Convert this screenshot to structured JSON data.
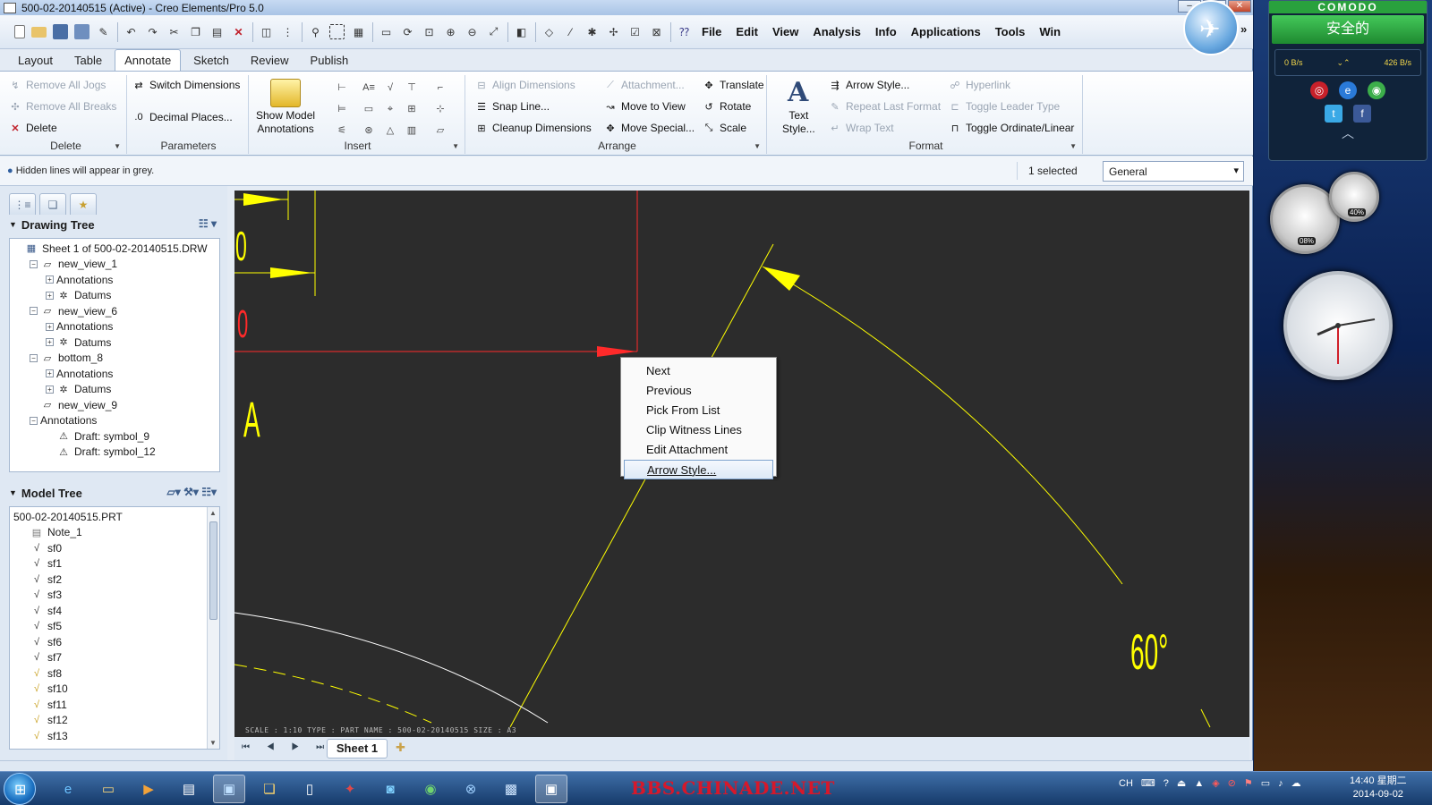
{
  "window": {
    "title": "500-02-20140515 (Active) - Creo Elements/Pro 5.0",
    "min_label": "–",
    "max_label": "❐",
    "close_label": "✕"
  },
  "menus": [
    "File",
    "Edit",
    "View",
    "Analysis",
    "Info",
    "Applications",
    "Tools",
    "Win"
  ],
  "more_label": "»",
  "ribbon_tabs": [
    "Layout",
    "Table",
    "Annotate",
    "Sketch",
    "Review",
    "Publish"
  ],
  "active_tab": "Annotate",
  "ribbon": {
    "delete_group": {
      "label": "Delete",
      "remove_jogs": "Remove All Jogs",
      "remove_breaks": "Remove All Breaks",
      "delete": "Delete"
    },
    "parameters_group": {
      "label": "Parameters",
      "switch_dimensions": "Switch Dimensions",
      "decimal_places": "Decimal Places..."
    },
    "insert_group": {
      "label": "Insert",
      "show_model_annotations_1": "Show Model",
      "show_model_annotations_2": "Annotations"
    },
    "arrange_group": {
      "label": "Arrange",
      "align_dimensions": "Align Dimensions",
      "snap_line": "Snap Line...",
      "cleanup_dimensions": "Cleanup Dimensions",
      "attachment": "Attachment...",
      "move_to_view": "Move to View",
      "move_special": "Move Special...",
      "translate": "Translate",
      "rotate": "Rotate",
      "scale": "Scale"
    },
    "format_group": {
      "label": "Format",
      "text_style_1": "Text",
      "text_style_2": "Style...",
      "arrow_style": "Arrow Style...",
      "repeat_last_format": "Repeat Last Format",
      "wrap_text": "Wrap Text",
      "hyperlink": "Hyperlink",
      "toggle_leader_type": "Toggle Leader Type",
      "toggle_ordinate": "Toggle Ordinate/Linear"
    }
  },
  "message_bar": {
    "message": "Hidden lines will appear in grey.",
    "selected": "1 selected",
    "filter": "General"
  },
  "drawing_tree": {
    "title": "Drawing Tree",
    "items": [
      {
        "label": "Sheet 1 of 500-02-20140515.DRW",
        "level": 0,
        "exp": "",
        "icon": "sheet"
      },
      {
        "label": "new_view_1",
        "level": 1,
        "exp": "−",
        "icon": "view"
      },
      {
        "label": "Annotations",
        "level": 2,
        "exp": "+",
        "icon": ""
      },
      {
        "label": "Datums",
        "level": 2,
        "exp": "+",
        "icon": "datum"
      },
      {
        "label": "new_view_6",
        "level": 1,
        "exp": "−",
        "icon": "view"
      },
      {
        "label": "Annotations",
        "level": 2,
        "exp": "+",
        "icon": ""
      },
      {
        "label": "Datums",
        "level": 2,
        "exp": "+",
        "icon": "datum"
      },
      {
        "label": "bottom_8",
        "level": 1,
        "exp": "−",
        "icon": "view"
      },
      {
        "label": "Annotations",
        "level": 2,
        "exp": "+",
        "icon": ""
      },
      {
        "label": "Datums",
        "level": 2,
        "exp": "+",
        "icon": "datum"
      },
      {
        "label": "new_view_9",
        "level": 1,
        "exp": "",
        "icon": "view"
      },
      {
        "label": "Annotations",
        "level": 1,
        "exp": "−",
        "icon": ""
      },
      {
        "label": "Draft: symbol_9",
        "level": 2,
        "exp": "",
        "icon": "symbol"
      },
      {
        "label": "Draft: symbol_12",
        "level": 2,
        "exp": "",
        "icon": "symbol"
      }
    ]
  },
  "model_tree": {
    "title": "Model Tree",
    "items": [
      {
        "label": "500-02-20140515.PRT",
        "level": 0,
        "icon": ""
      },
      {
        "label": "Note_1",
        "level": 1,
        "icon": "note"
      },
      {
        "label": "sf0",
        "level": 1,
        "icon": "sf"
      },
      {
        "label": "sf1",
        "level": 1,
        "icon": "sf"
      },
      {
        "label": "sf2",
        "level": 1,
        "icon": "sf"
      },
      {
        "label": "sf3",
        "level": 1,
        "icon": "sf"
      },
      {
        "label": "sf4",
        "level": 1,
        "icon": "sf"
      },
      {
        "label": "sf5",
        "level": 1,
        "icon": "sf"
      },
      {
        "label": "sf6",
        "level": 1,
        "icon": "sf"
      },
      {
        "label": "sf7",
        "level": 1,
        "icon": "sf"
      },
      {
        "label": "sf8",
        "level": 1,
        "icon": "sfp"
      },
      {
        "label": "sf10",
        "level": 1,
        "icon": "sfp"
      },
      {
        "label": "sf11",
        "level": 1,
        "icon": "sfp"
      },
      {
        "label": "sf12",
        "level": 1,
        "icon": "sfp"
      },
      {
        "label": "sf13",
        "level": 1,
        "icon": "sfp"
      }
    ]
  },
  "canvas": {
    "status_line": "SCALE : 1:10    TYPE : PART   NAME : 500-02-20140515   SIZE : A3",
    "dim_60": "60°",
    "label_a": "A",
    "label_0": "0",
    "colors": {
      "background": "#2c2c2c",
      "annotation": "#ffff00",
      "selected": "#ff2a2a",
      "geometry": "#ffffff"
    }
  },
  "context_menu": {
    "items": [
      "Next",
      "Previous",
      "Pick From List",
      "Clip Witness Lines",
      "Edit Attachment",
      "Arrow Style..."
    ],
    "highlighted": "Arrow Style..."
  },
  "sheet_bar": {
    "nav": "⏮ ◀ ▶ ⏭",
    "tab": "Sheet 1"
  },
  "desktop": {
    "comodo_brand": "COMODO",
    "comodo_status": "安全的",
    "download": "0 B/s",
    "upload": "426 B/s",
    "cpu": "08%",
    "mem": "40%"
  },
  "taskbar": {
    "watermark": "BBS.CHINADE.NET",
    "ime": "CH",
    "time": "14:40 星期二",
    "date": "2014-09-02"
  }
}
